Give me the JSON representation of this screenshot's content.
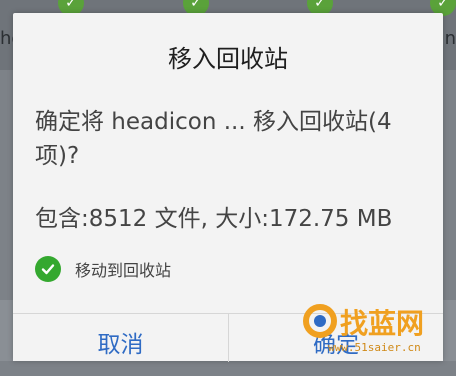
{
  "background": {
    "left_fragment": "he",
    "right_fragment": "n",
    "check_mark": "✓"
  },
  "dialog": {
    "title": "移入回收站",
    "message": "确定将 headicon ... 移入回收站(4项)?",
    "info": "包含:8512 文件, 大小:172.75 MB",
    "option_label": "移动到回收站",
    "option_checked": true,
    "cancel_label": "取消",
    "ok_label": "确定"
  },
  "watermark": {
    "logo_text": "找蓝网",
    "url": "www.51saier.cn",
    "brand_color": "#f0a020"
  },
  "colors": {
    "accent": "#2f6bc4",
    "check_green": "#34a82f",
    "dialog_bg": "#f3f3f3"
  }
}
